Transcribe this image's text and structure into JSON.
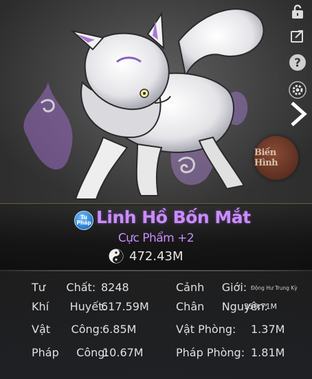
{
  "pet": {
    "badge_line1": "Tu",
    "badge_line2": "Pháp",
    "name": "Linh Hồ Bốn Mắt",
    "grade": "Cực Phẩm +2",
    "power": "472.43M"
  },
  "actions": {
    "transform_label": "Biến Hình"
  },
  "icons": [
    "lock-icon",
    "share-icon",
    "help-icon",
    "settings-icon",
    "next-arrow-icon",
    "yin-yang-icon"
  ],
  "stats": {
    "tu_chat_label": "Tư      Chất:",
    "tu_chat_value": "8248",
    "canh_gioi_label": "Cảnh     Giới:",
    "canh_gioi_value": "Động Hư Trung Kỳ",
    "khi_huyet_label": "Khí      Huyết:",
    "khi_huyet_value": "617.59M",
    "chan_nguyen_label": "Chân     Nguyên:",
    "chan_nguyen_value": "350.71M",
    "vat_cong_label": "Vật      Công:",
    "vat_cong_value": "6.85M",
    "vat_phong_label": "Vật Phòng:",
    "vat_phong_value": "1.37M",
    "phap_cong_label": "Pháp     Công:",
    "phap_cong_value": "10.67M",
    "phap_phong_label": "Pháp Phòng:",
    "phap_phong_value": "1.81M"
  },
  "colors": {
    "name_purple": "#c98cff",
    "text_light": "#e0e0e0",
    "transform_button": "#6b3828"
  }
}
